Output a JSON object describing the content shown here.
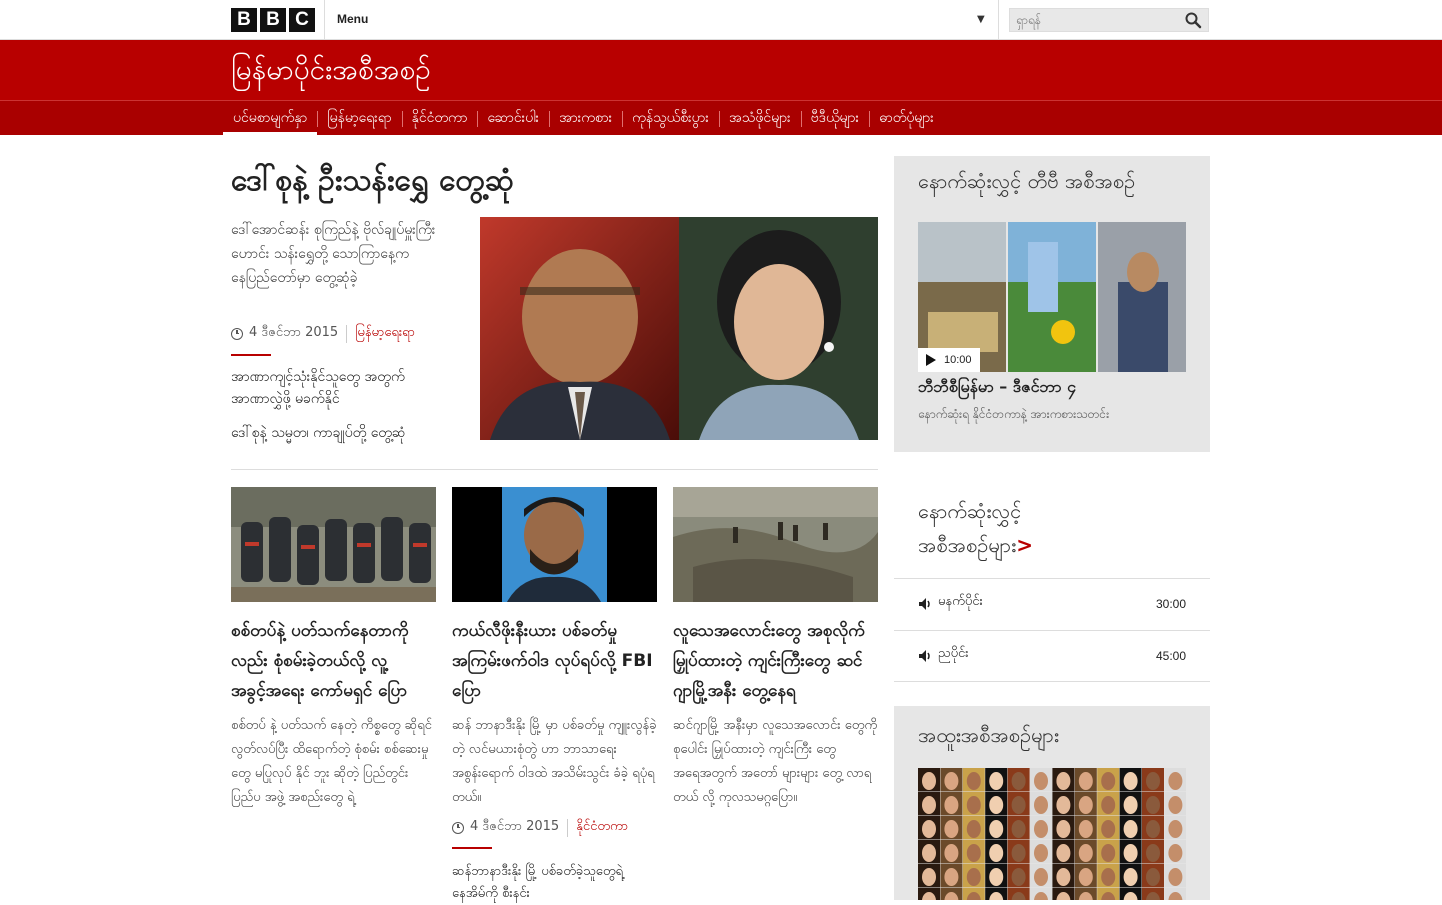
{
  "header": {
    "logo_letters": [
      "B",
      "B",
      "C"
    ],
    "menu_label": "Menu",
    "search_placeholder": "ရှာရန်"
  },
  "masthead": {
    "title": "မြန်မာပိုင်းအစီအစဉ်"
  },
  "nav": {
    "items": [
      {
        "label": "ပင်မစာမျက်နှာ",
        "active": true
      },
      {
        "label": "မြန်မာ့ရေးရာ"
      },
      {
        "label": "နိုင်ငံတကာ"
      },
      {
        "label": "ဆောင်းပါး"
      },
      {
        "label": "အားကစား"
      },
      {
        "label": "ကုန်သွယ်စီးပွား"
      },
      {
        "label": "အသံဖိုင်များ"
      },
      {
        "label": "ဗီဒီယိုများ"
      },
      {
        "label": "ဓာတ်ပုံများ"
      }
    ]
  },
  "lead": {
    "headline": "ဒေါ်စုနဲ့ ဦးသန်းရွှေ တွေ့ဆုံ",
    "summary": "ဒေါ်အောင်ဆန်း စုကြည်နဲ့ ဗိုလ်ချုပ်မှူးကြီးဟောင်း သန်းရွှေတို့ သောကြာနေ့က နေပြည်တော်မှာ တွေ့ဆုံခဲ့",
    "date": "4 ဒီဇင်ဘာ 2015",
    "category": "မြန်မာ့ရေးရာ",
    "related": [
      "အာဏာကျင့်သုံးနိုင်သူတွေ အတွက် အာဏာလွှဲဖို့ မခက်နိုင်",
      "ဒေါ်စုနဲ့ သမ္မတ၊ ကာချုပ်တို့ တွေ့ဆုံ"
    ]
  },
  "cards": [
    {
      "headline": "စစ်တပ်နဲ့ ပတ်သက်နေတာကိုလည်း စုံစမ်းခဲ့တယ်လို့ လူ့အခွင့်အရေး ကော်မရှင် ပြော",
      "summary": "စစ်တပ် နဲ့ ပတ်သက် နေတဲ့ ကိစ္စတွေ ဆိုရင် လွတ်လပ်ပြီး ထိရောက်တဲ့ စုံစမ်း စစ်ဆေးမှု တွေ မပြုလုပ် နိုင် ဘူး ဆိုတဲ့ ပြည်တွင်း ပြည်ပ အဖွဲ့ အစည်းတွေ ရဲ့"
    },
    {
      "headline": "ကယ်လီဖိုးနီးယား ပစ်ခတ်မှု အကြမ်းဖက်ဝါဒ လုပ်ရပ်လို့ FBI ပြော",
      "summary": "ဆန် ဘာနာဒီးနိုး မြို့ မှာ ပစ်ခတ်မှု ကျူးလွန်ခဲ့တဲ့ လင်မယားစုံတွဲ ဟာ ဘာသာရေး အစွန်းရောက် ဝါဒထဲ အသိမ်းသွင်း ခံခဲ့ ရပုံရတယ်။",
      "date": "4 ဒီဇင်ဘာ 2015",
      "category": "နိုင်ငံတကာ",
      "related": "ဆန်ဘာနာဒီးနိုး မြို့ ပစ်ခတ်ခဲ့သူတွေရဲ့ နေအိမ်ကို စီးနင်း"
    },
    {
      "headline": "လူသေအလောင်းတွေ အစုလိုက်မြှုပ်ထားတဲ့ ကျင်းကြီးတွေ ဆင်ဂျာမြို့အနီး တွေ့နေရ",
      "summary": "ဆင်ဂျာမြို့ အနီးမှာ လူသေအလောင်း တွေကို စုပေါင်း မြှုပ်ထားတဲ့ ကျင်းကြီး တွေ အရေအတွက် အတော် များများ တွေ့ လာရတယ် လို့ ကုလသမဂ္ဂပြော။"
    }
  ],
  "tv": {
    "title": "နောက်ဆုံးလွှင့် တီဗီ အစီအစဉ်",
    "duration": "10:00",
    "caption": "ဘီဘီစီမြန်မာ – ဒီဇင်ဘာ ၄",
    "subtitle": "နောက်ဆုံးရ နိုင်ငံတကာနဲ့ အားကစားသတင်း"
  },
  "radio": {
    "title_line1": "နောက်ဆုံးလွှင့်",
    "title_line2": "အစီအစဉ်များ",
    "chevron": ">",
    "items": [
      {
        "name": "မနက်ပိုင်း",
        "duration": "30:00"
      },
      {
        "name": "ညပိုင်း",
        "duration": "45:00"
      }
    ]
  },
  "special": {
    "title": "အထူးအစီအစဉ်များ"
  },
  "colors": {
    "brand_red": "#b80000",
    "nav_red": "#a90000",
    "panel_gray": "#e6e6e6"
  },
  "icons": [
    "search-icon",
    "chevron-down-icon",
    "clock-icon",
    "play-icon",
    "speaker-icon"
  ]
}
